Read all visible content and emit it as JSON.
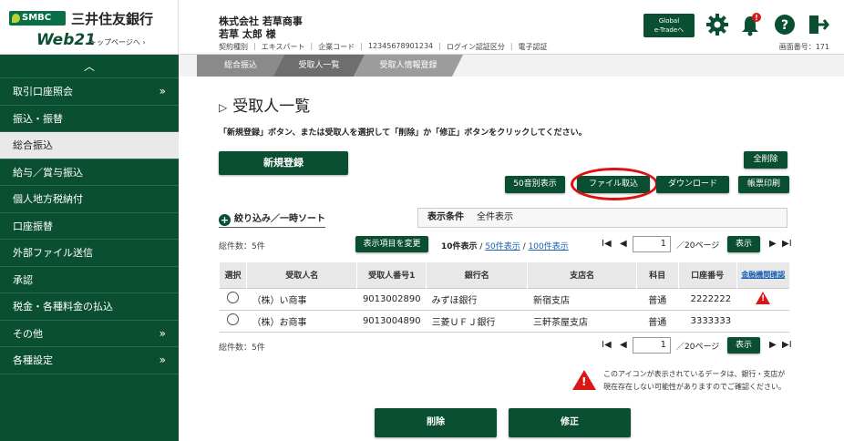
{
  "brand": {
    "logo_mark": "SMBC",
    "bank_name": "三井住友銀行",
    "product": "Web21",
    "top_link": "トップページへ ›"
  },
  "header": {
    "company": "株式会社 若草商事",
    "user": "若草 太郎 様",
    "info": [
      "契約種別",
      "エキスパート",
      "企業コード",
      "12345678901234",
      "ログイン認証区分",
      "電子認証"
    ],
    "global_btn_line1": "Global",
    "global_btn_line2": "e-Tradeへ",
    "notification_badge": "!",
    "screen_no": "画面番号：171",
    "icons": [
      "gear-icon",
      "bell-icon",
      "help-icon",
      "logout-icon"
    ]
  },
  "sidebar": {
    "collapse": "︿",
    "items": [
      {
        "label": "取引口座照会",
        "arrow": "»"
      },
      {
        "label": "振込・振替",
        "arrow": ""
      },
      {
        "label": "総合振込",
        "arrow": ""
      },
      {
        "label": "給与／賞与振込",
        "arrow": ""
      },
      {
        "label": "個人地方税納付",
        "arrow": ""
      },
      {
        "label": "口座振替",
        "arrow": ""
      },
      {
        "label": "外部ファイル送信",
        "arrow": ""
      },
      {
        "label": "承認",
        "arrow": ""
      },
      {
        "label": "税金・各種料金の払込",
        "arrow": ""
      },
      {
        "label": "その他",
        "arrow": "»"
      },
      {
        "label": "各種設定",
        "arrow": "»"
      }
    ]
  },
  "breadcrumb": [
    "総合振込",
    "受取人一覧",
    "受取人情報登録"
  ],
  "main": {
    "title_marker": "▷",
    "title": "受取人一覧",
    "instruction": "「新規登録」ボタン、または受取人を選択して「削除」か「修正」ボタンをクリックしてください。",
    "new_btn": "新規登録",
    "delete_all_btn": "全削除",
    "btn_50": "50音別表示",
    "btn_file": "ファイル取込",
    "btn_download": "ダウンロード",
    "btn_print": "帳票印刷",
    "filter_link": "絞り込み／一時ソート",
    "cond_label": "表示条件",
    "cond_value": "全件表示",
    "total": "総件数：5件",
    "cols_btn": "表示項目を変更",
    "perpage_current": "10件表示",
    "perpage_sep1": "/",
    "perpage_50": "50件表示",
    "perpage_sep2": "/",
    "perpage_100": "100件表示",
    "page_first": "I◀",
    "page_prev": "◀",
    "page_next": "▶",
    "page_last": "▶I",
    "page_value": "1",
    "page_total": "／20ページ",
    "show_btn": "表示",
    "columns": [
      "選択",
      "受取人名",
      "受取人番号1",
      "銀行名",
      "支店名",
      "科目",
      "口座番号",
      "金融機関確認"
    ],
    "rows": [
      {
        "name": "（株）い商事",
        "number": "9013002890",
        "bank": "みずほ銀行",
        "branch": "新宿支店",
        "type": "普通",
        "account": "2222222",
        "warning": "!"
      },
      {
        "name": "（株）お商事",
        "number": "9013004890",
        "bank": "三菱ＵＦＪ銀行",
        "branch": "三軒茶屋支店",
        "type": "普通",
        "account": "3333333",
        "warning": ""
      }
    ],
    "note": "このアイコンが表示されているデータは、銀行・支店が現在存在しない可能性がありますのでご確認ください。",
    "note_icon_mark": "!",
    "delete_btn": "削除",
    "modify_btn": "修正"
  }
}
